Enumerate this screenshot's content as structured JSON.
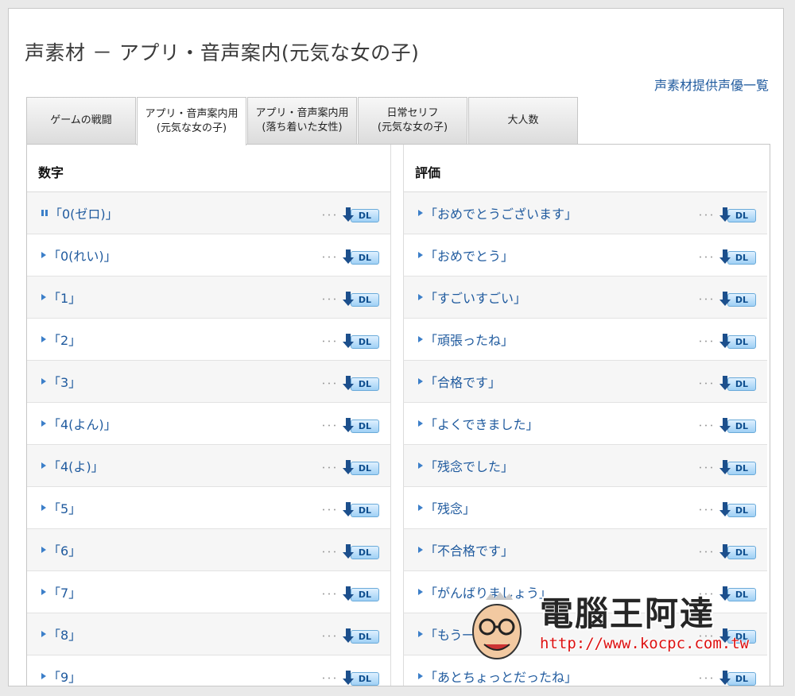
{
  "page": {
    "title": "声素材 － アプリ・音声案内(元気な女の子)",
    "voice_actor_link": "声素材提供声優一覧"
  },
  "tabs": [
    {
      "label": "ゲームの戦闘",
      "active": false
    },
    {
      "label": "アプリ・音声案内用\n(元気な女の子)",
      "active": true
    },
    {
      "label": "アプリ・音声案内用\n(落ち着いた女性)",
      "active": false
    },
    {
      "label": "日常セリフ\n(元気な女の子)",
      "active": false
    },
    {
      "label": "大人数",
      "active": false
    }
  ],
  "left_column": {
    "heading": "数字",
    "items": [
      {
        "label": "「0(ゼロ)」",
        "state": "paused"
      },
      {
        "label": "「0(れい)」",
        "state": "play"
      },
      {
        "label": "「1」",
        "state": "play"
      },
      {
        "label": "「2」",
        "state": "play"
      },
      {
        "label": "「3」",
        "state": "play"
      },
      {
        "label": "「4(よん)」",
        "state": "play"
      },
      {
        "label": "「4(よ)」",
        "state": "play"
      },
      {
        "label": "「5」",
        "state": "play"
      },
      {
        "label": "「6」",
        "state": "play"
      },
      {
        "label": "「7」",
        "state": "play"
      },
      {
        "label": "「8」",
        "state": "play"
      },
      {
        "label": "「9」",
        "state": "play"
      }
    ]
  },
  "right_column": {
    "heading": "評価",
    "items": [
      {
        "label": "「おめでとうございます」",
        "state": "play"
      },
      {
        "label": "「おめでとう」",
        "state": "play"
      },
      {
        "label": "「すごいすごい」",
        "state": "play"
      },
      {
        "label": "「頑張ったね」",
        "state": "play"
      },
      {
        "label": "「合格です」",
        "state": "play"
      },
      {
        "label": "「よくできました」",
        "state": "play"
      },
      {
        "label": "「残念でした」",
        "state": "play"
      },
      {
        "label": "「残念」",
        "state": "play"
      },
      {
        "label": "「不合格です」",
        "state": "play"
      },
      {
        "label": "「がんばりましょう」",
        "state": "play"
      },
      {
        "label": "「もう一回です」",
        "state": "play"
      },
      {
        "label": "「あとちょっとだったね」",
        "state": "play"
      }
    ]
  },
  "download": {
    "dots": "･･･",
    "label": "DL"
  },
  "watermark": {
    "text": "電腦王阿達",
    "url": "http://www.kocpc.com.tw"
  },
  "colors": {
    "link": "#1f5a9e",
    "play_icon": "#3c7fc9",
    "watermark_url": "#dd1111"
  }
}
